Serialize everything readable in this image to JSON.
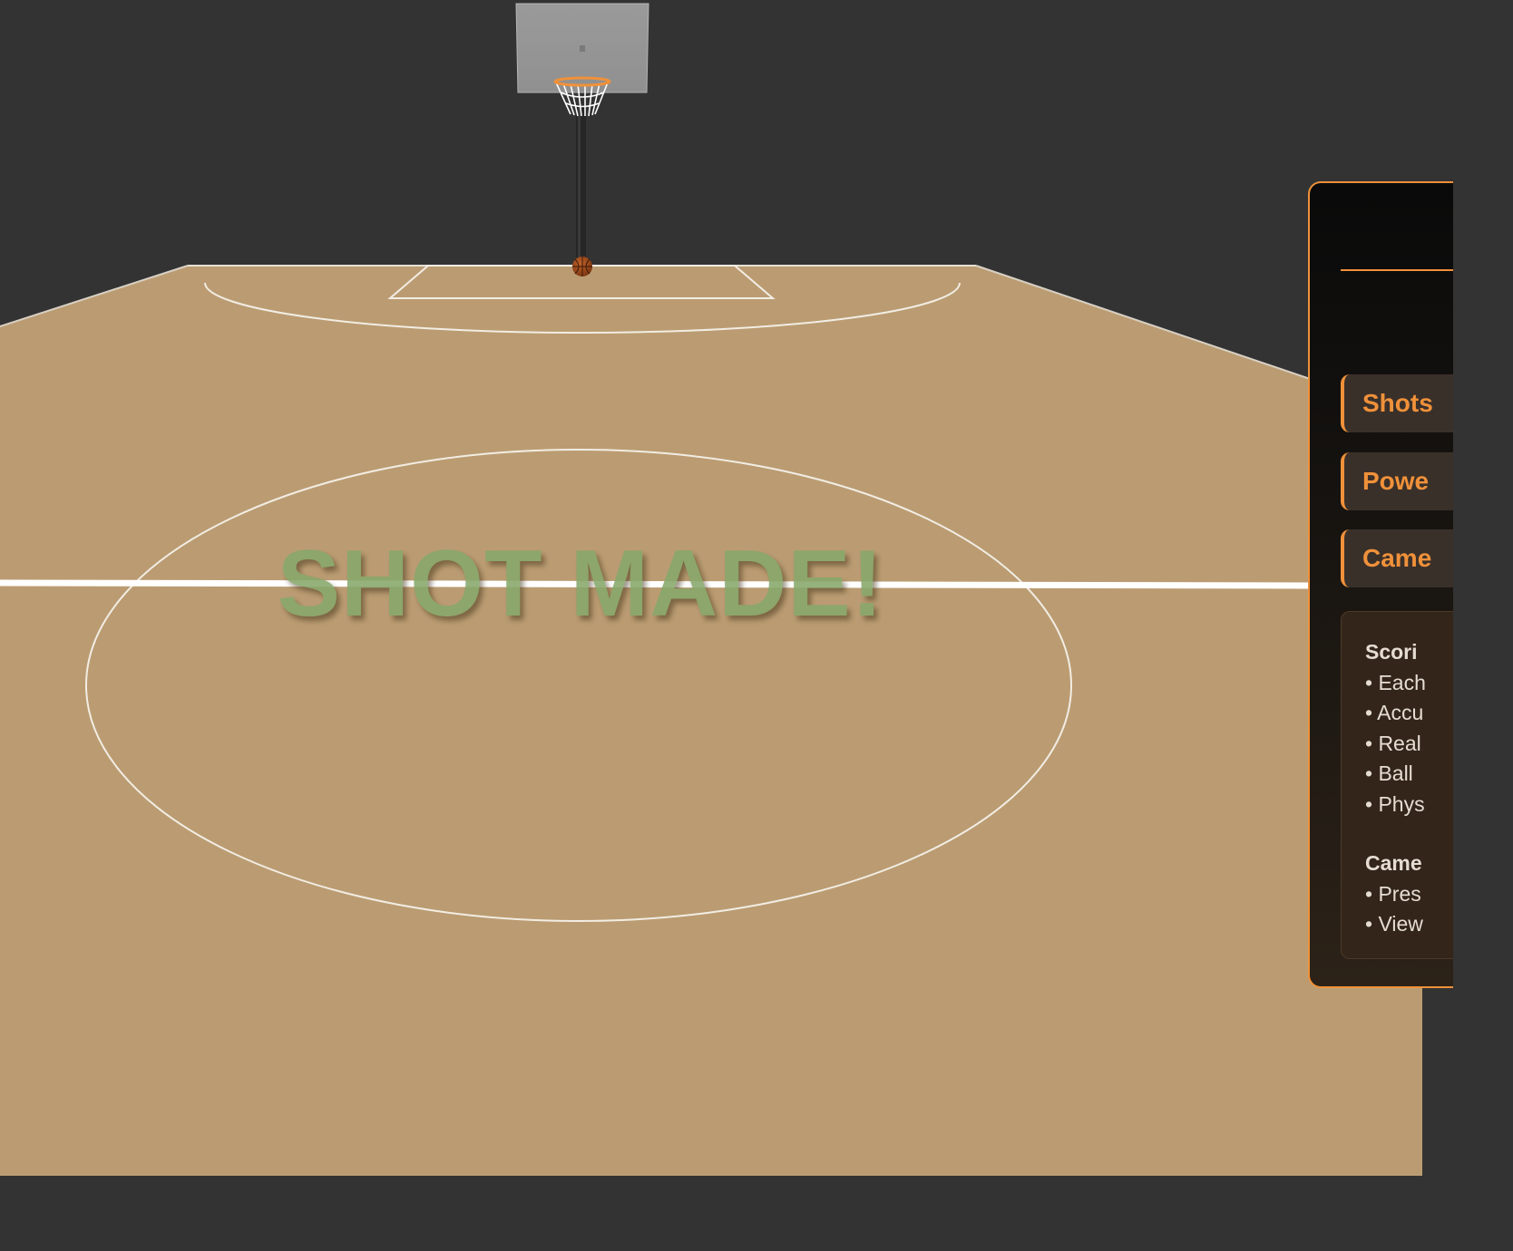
{
  "scene": {
    "background_color": "#333333",
    "court_color": "#bb9c72",
    "line_color": "#f2ede4",
    "banner_color": "#87a86b",
    "accent_color": "#f0913a"
  },
  "hoop": {
    "backboard_icon": "backboard-icon",
    "rim_icon": "rim-icon",
    "net_icon": "net-icon",
    "pole_icon": "pole-icon"
  },
  "ball": {
    "icon": "basketball-icon"
  },
  "banner": {
    "text": "SHOT MADE!"
  },
  "panel": {
    "stats": [
      {
        "label": "Shots"
      },
      {
        "label": "Powe"
      },
      {
        "label": "Came"
      }
    ],
    "info": {
      "scoring_heading": "Scori",
      "scoring_items": [
        "• Each",
        "• Accu",
        "• Real",
        "• Ball",
        "• Phys"
      ],
      "camera_heading": "Came",
      "camera_items": [
        "• Pres",
        "• View"
      ]
    }
  }
}
